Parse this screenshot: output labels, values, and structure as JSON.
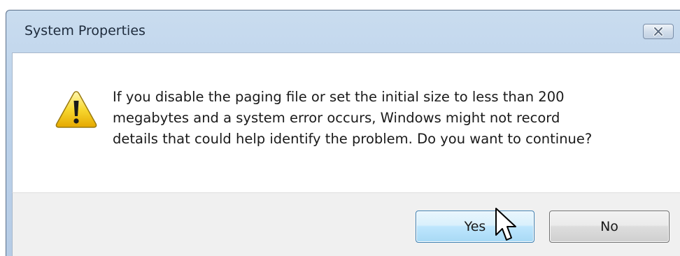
{
  "window": {
    "title": "System Properties",
    "close_icon": "close-icon"
  },
  "dialog": {
    "icon": "warning-icon",
    "message_lines": [
      "If you disable the paging file or set the initial size to less than 200",
      "megabytes and a system error occurs, Windows might not record",
      "details that could help identify the problem. Do you want to continue?"
    ]
  },
  "buttons": {
    "yes_label": "Yes",
    "no_label": "No"
  },
  "cursor": {
    "icon": "mouse-pointer-icon"
  },
  "colors": {
    "title_bar": "#bcd2ea",
    "footer": "#f0f0f0",
    "default_button": "#bee6fd"
  }
}
